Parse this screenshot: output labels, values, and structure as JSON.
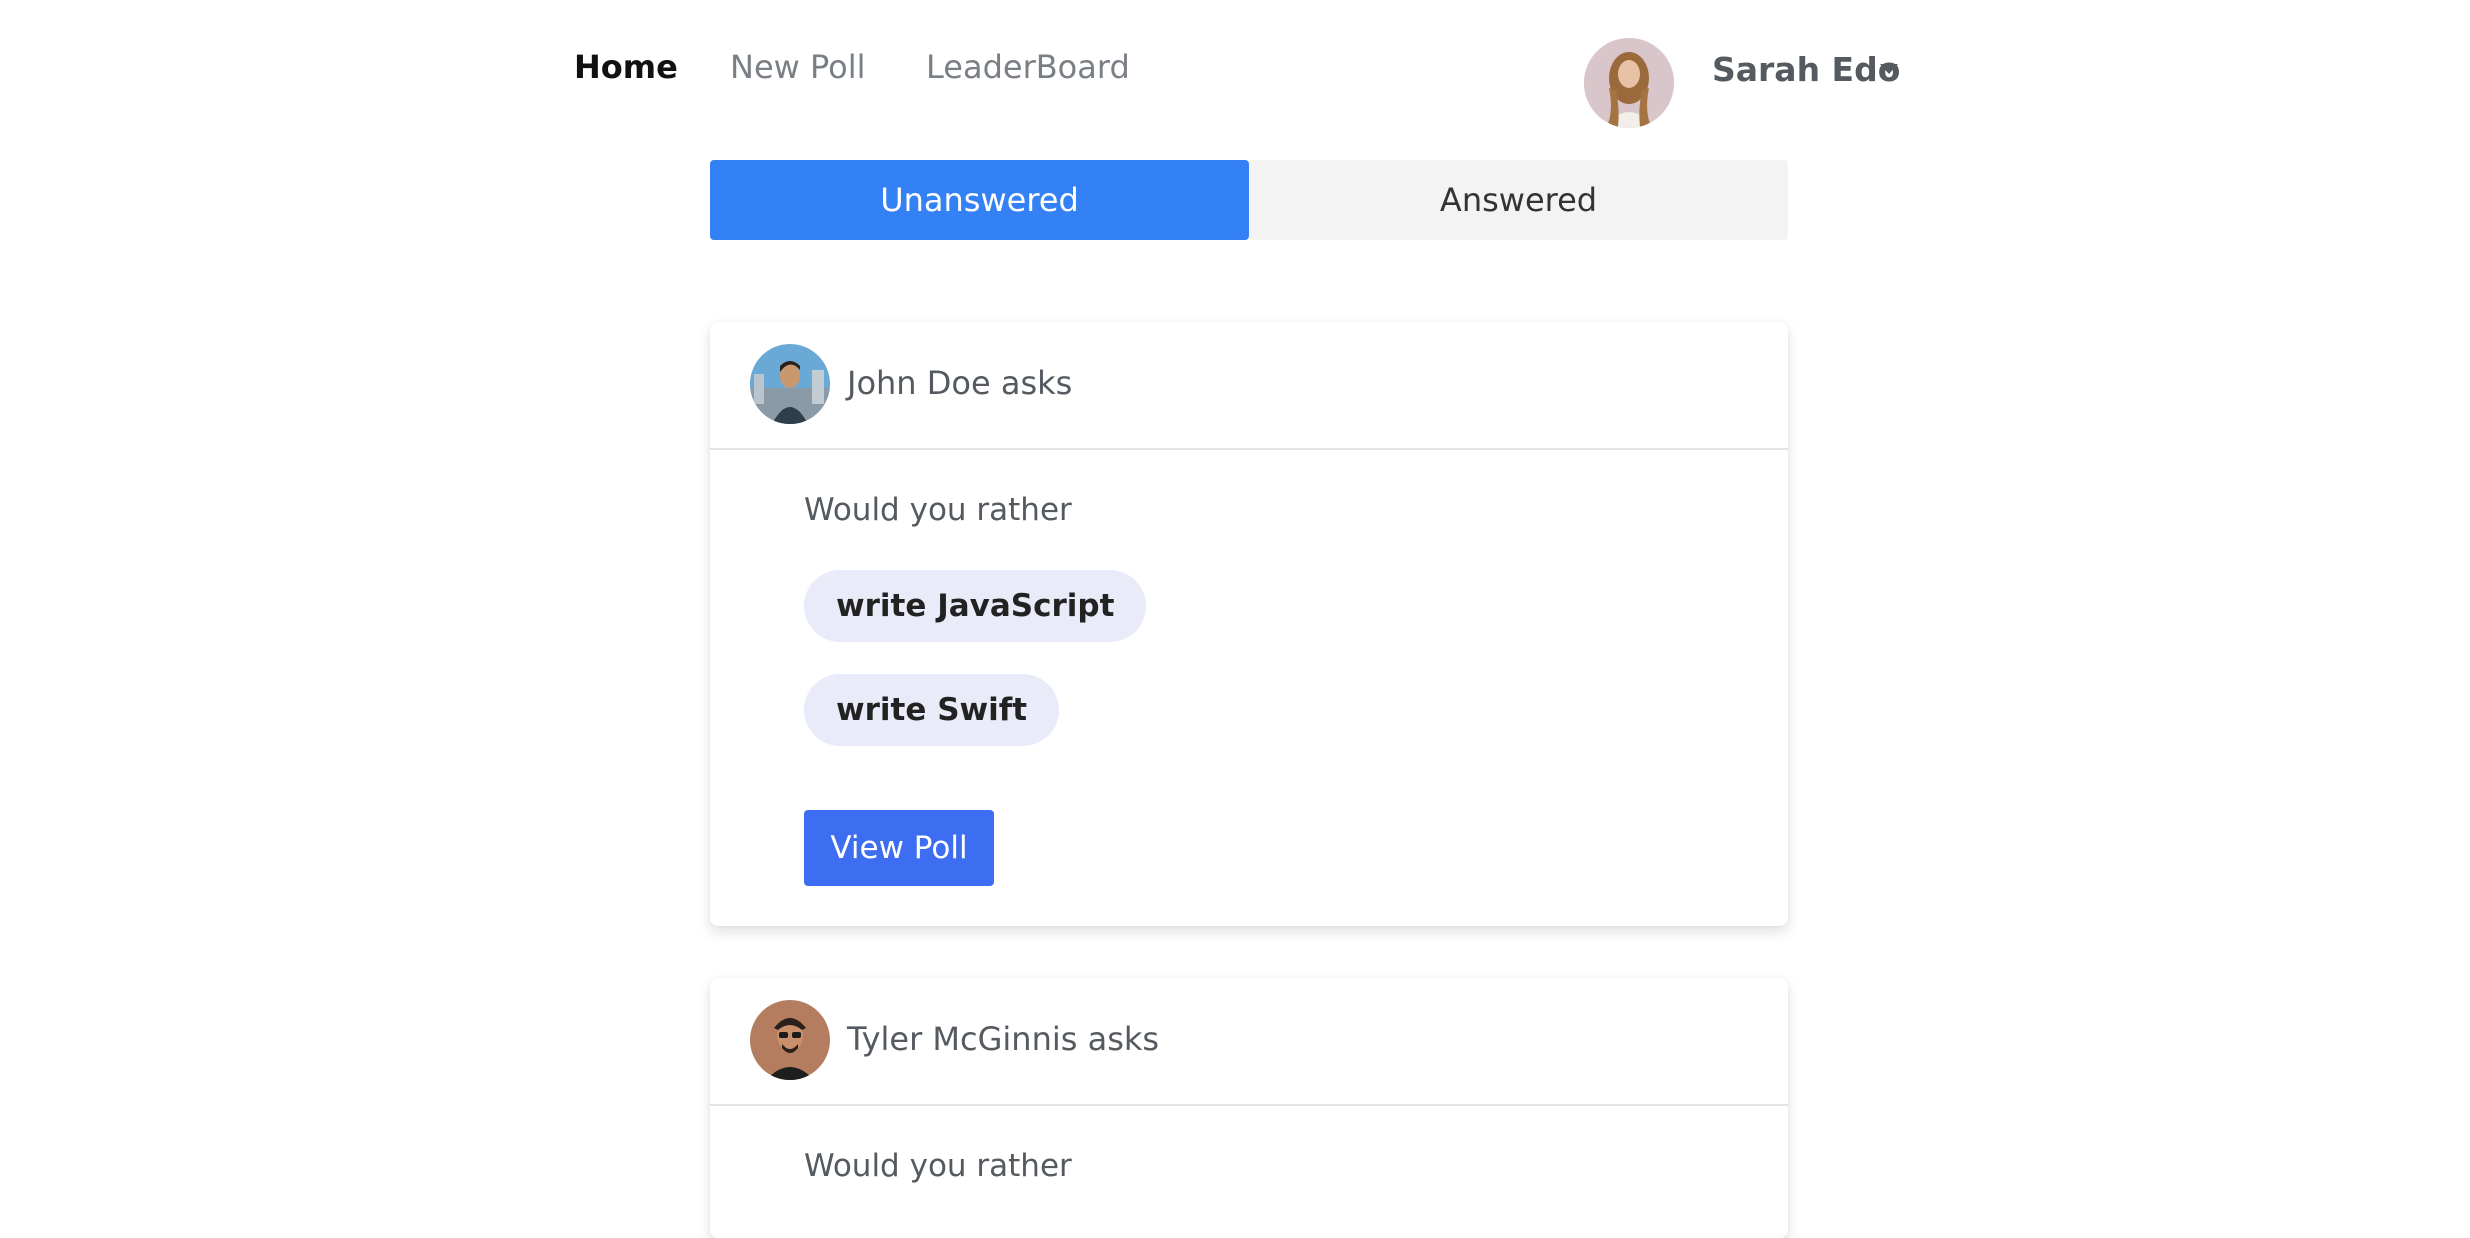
{
  "nav": {
    "home": "Home",
    "new_poll": "New Poll",
    "leaderboard": "LeaderBoard"
  },
  "user": {
    "name": "Sarah Edo"
  },
  "tabs": {
    "unanswered": "Unanswered",
    "answered": "Answered"
  },
  "questions": [
    {
      "asker": "John Doe asks",
      "prompt": "Would you rather",
      "option_one": "write JavaScript",
      "option_two": "write Swift",
      "button": "View Poll"
    },
    {
      "asker": "Tyler McGinnis asks",
      "prompt": "Would you rather"
    }
  ],
  "colors": {
    "accent": "#3480f5",
    "button": "#3d6ef2",
    "option_bg": "#e9ebf8"
  }
}
